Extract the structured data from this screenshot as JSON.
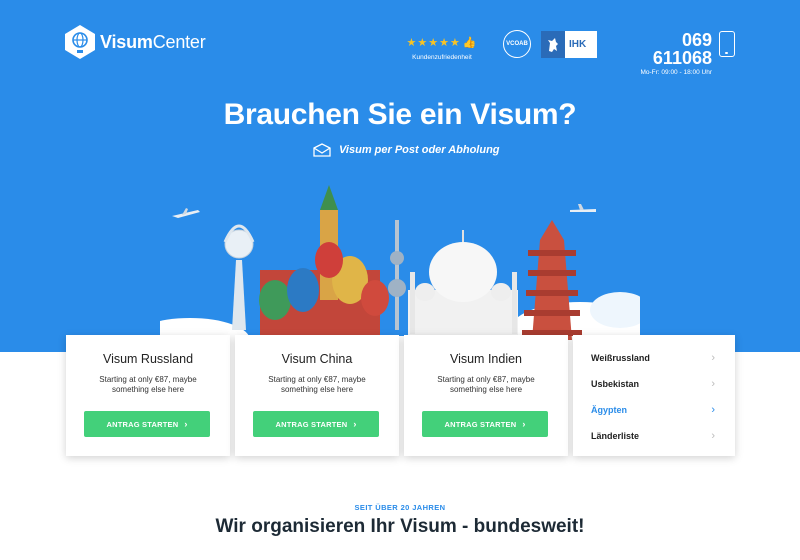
{
  "header": {
    "logo_bold": "Visum",
    "logo_light": "Center",
    "rating_label": "Kundenzufriedenheit",
    "stars": 5,
    "badge_vcoab": "VCOAB",
    "badge_ihk": "IHK",
    "phone_number": "069 611068",
    "phone_hours": "Mo-Fr: 09:00 - 18:00 Uhr"
  },
  "hero": {
    "headline": "Brauchen Sie ein Visum?",
    "subline": "Visum per Post oder Abholung"
  },
  "cards": [
    {
      "title": "Visum Russland",
      "desc": "Starting at only €87, maybe something else here",
      "button": "ANTRAG STARTEN"
    },
    {
      "title": "Visum China",
      "desc": "Starting at only €87, maybe something else here",
      "button": "ANTRAG STARTEN"
    },
    {
      "title": "Visum Indien",
      "desc": "Starting at only €87, maybe something else here",
      "button": "ANTRAG STARTEN"
    }
  ],
  "menu": {
    "items": [
      {
        "label": "Weißrussland"
      },
      {
        "label": "Usbekistan"
      },
      {
        "label": "Ägypten",
        "active": true
      },
      {
        "label": "Länderliste"
      }
    ]
  },
  "section": {
    "eyebrow": "SEIT ÜBER 20 JAHREN",
    "title": "Wir organisieren Ihr Visum - bundesweit!"
  },
  "colors": {
    "brand_blue": "#2a8ce9",
    "button_green": "#43d07a",
    "star_yellow": "#f7c325"
  }
}
